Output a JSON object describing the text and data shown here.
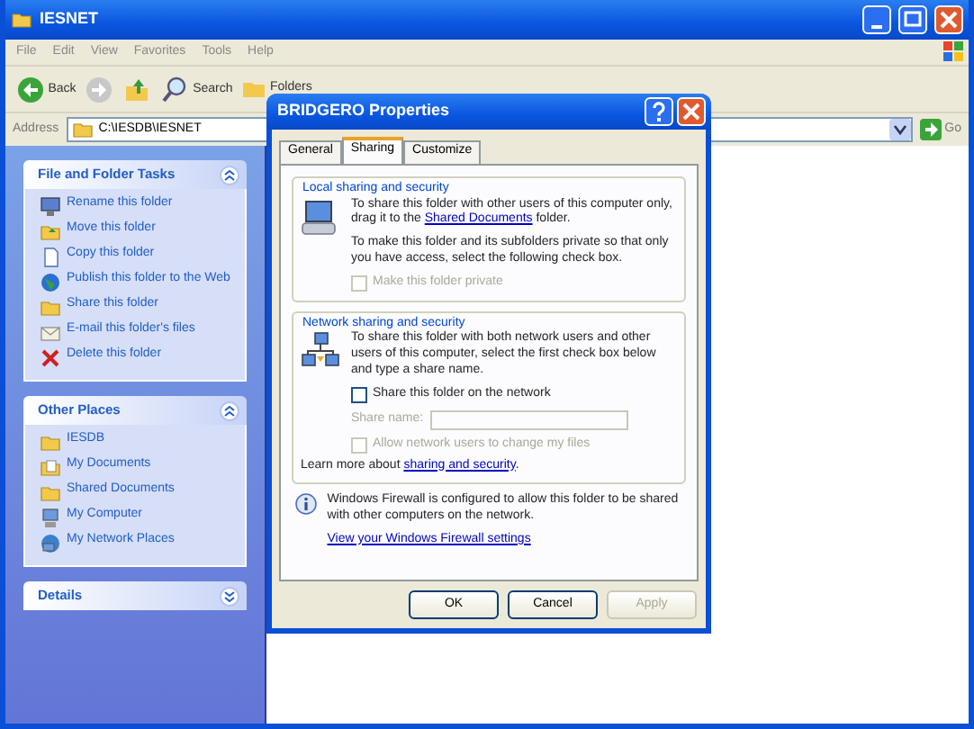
{
  "window": {
    "title": "IESNET"
  },
  "menu": [
    "File",
    "Edit",
    "View",
    "Favorites",
    "Tools",
    "Help"
  ],
  "toolbar": {
    "back": "Back",
    "search": "Search",
    "folders": "Folders"
  },
  "address": {
    "label": "Address",
    "value": "C:\\IESDB\\IESNET",
    "go": "Go"
  },
  "task_panes": [
    {
      "title": "File and Folder Tasks",
      "expanded": true,
      "items": [
        {
          "label": "Rename this folder",
          "kind": "rename"
        },
        {
          "label": "Move this folder",
          "kind": "move"
        },
        {
          "label": "Copy this folder",
          "kind": "copy"
        },
        {
          "label": "Publish this folder to the Web",
          "kind": "publish"
        },
        {
          "label": "Share this folder",
          "kind": "share"
        },
        {
          "label": "E-mail this folder's files",
          "kind": "email"
        },
        {
          "label": "Delete this folder",
          "kind": "delete"
        }
      ]
    },
    {
      "title": "Other Places",
      "expanded": true,
      "items": [
        {
          "label": "IESDB",
          "kind": "folder"
        },
        {
          "label": "My Documents",
          "kind": "documents"
        },
        {
          "label": "Shared Documents",
          "kind": "folder"
        },
        {
          "label": "My Computer",
          "kind": "computer"
        },
        {
          "label": "My Network Places",
          "kind": "network"
        }
      ]
    },
    {
      "title": "Details",
      "expanded": false
    }
  ],
  "dialog": {
    "title": "BRIDGERO Properties",
    "tabs": [
      {
        "label": "General",
        "selected": false
      },
      {
        "label": "Sharing",
        "selected": true
      },
      {
        "label": "Customize",
        "selected": false
      }
    ],
    "local": {
      "heading": "Local sharing and security",
      "text_before": "To share this folder with other users of this computer only, drag it to the ",
      "link": "Shared Documents",
      "text_after": " folder.",
      "private_text": "To make this folder and its subfolders private so that only you have access, select the following check box.",
      "private_checkbox": {
        "label": "Make this folder private",
        "checked": false,
        "disabled": true
      }
    },
    "network": {
      "heading": "Network sharing and security",
      "text": "To share this folder with both network users and other users of this computer, select the first check box below and type a share name.",
      "share_checkbox": {
        "label": "Share this folder on the network",
        "checked": false,
        "disabled": false
      },
      "share_name": {
        "label": "Share name:",
        "disabled": true
      },
      "change_checkbox": {
        "label": "Allow network users to change my files",
        "checked": false,
        "disabled": true
      },
      "learn_before": "Learn more about ",
      "learn_link": "sharing and security",
      "learn_after": "."
    },
    "firewall": {
      "text": "Windows Firewall is configured to allow this folder to be shared with other computers on the network.",
      "link": "View your Windows Firewall settings"
    },
    "buttons": [
      {
        "label": "OK",
        "disabled": false
      },
      {
        "label": "Cancel",
        "disabled": false
      },
      {
        "label": "Apply",
        "disabled": true
      }
    ]
  }
}
